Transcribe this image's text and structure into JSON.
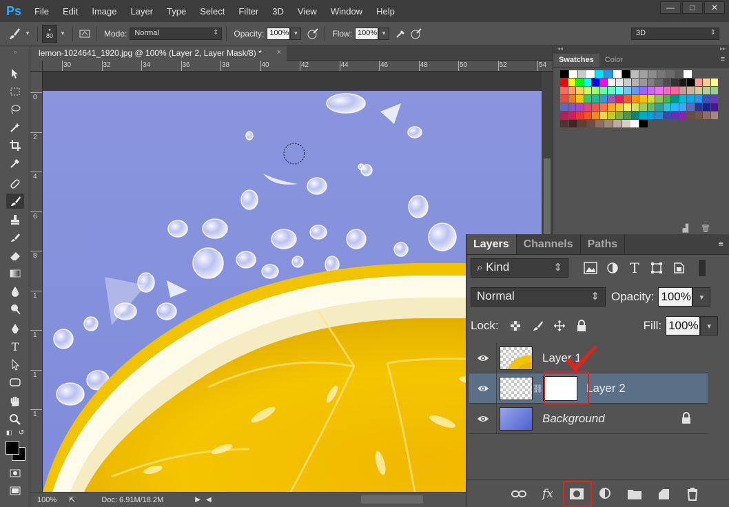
{
  "app": {
    "logo": "Ps",
    "menu": [
      "File",
      "Edit",
      "Image",
      "Layer",
      "Type",
      "Select",
      "Filter",
      "3D",
      "View",
      "Window",
      "Help"
    ],
    "window_controls": {
      "minimize": "—",
      "maximize": "□",
      "close": "✕"
    }
  },
  "options_bar": {
    "brush_size": "80",
    "mode_label": "Mode:",
    "mode_value": "Normal",
    "opacity_label": "Opacity:",
    "opacity_value": "100%",
    "flow_label": "Flow:",
    "flow_value": "100%",
    "workspace_value": "3D"
  },
  "document": {
    "tab_title": "lemon-1024641_1920.jpg @ 100% (Layer 2, Layer Mask/8) *",
    "close_glyph": "×",
    "ruler_h_labels": [
      "30",
      "32",
      "34",
      "36",
      "38",
      "40",
      "42",
      "44",
      "46",
      "48",
      "50",
      "52",
      "54"
    ],
    "ruler_v_labels": [
      "0",
      "2",
      "4",
      "6",
      "8",
      "1",
      "1",
      "1",
      "1"
    ],
    "status_zoom": "100%",
    "status_doc": "Doc: 6.91M/18.2M"
  },
  "swatches": {
    "tabs": [
      "Swatches",
      "Color"
    ],
    "menu_glyph": "≡",
    "colors": [
      [
        "#000000",
        "#ffffff",
        "#c8c8c8",
        "#ffffff",
        "#00e4ff",
        "#2196f3",
        "#ffffff",
        "#000000",
        "#bdbdbd",
        "#a0a0a0",
        "#8c8c8c",
        "#787878",
        "#6a6a6a",
        "#5a5a5a",
        "#ffffff"
      ],
      [
        "#ff0000",
        "#ffff00",
        "#00ff00",
        "#00ffff",
        "#0000ff",
        "#ff00ff",
        "#ffffff",
        "#e6e6e6",
        "#cccccc",
        "#b3b3b3",
        "#999999",
        "#808080",
        "#666666",
        "#4d4d4d",
        "#333333",
        "#1a1a1a",
        "#000000",
        "#ff9999",
        "#ffcc99",
        "#ffff99"
      ],
      [
        "#ff6666",
        "#ff9966",
        "#ffcc66",
        "#ccff66",
        "#99ff66",
        "#66ff99",
        "#66ffcc",
        "#66ffff",
        "#66ccff",
        "#6699ff",
        "#9966ff",
        "#cc66ff",
        "#ff66ff",
        "#ff66cc",
        "#ff6699",
        "#cc9999",
        "#ccb399",
        "#cccc99",
        "#b3cc99",
        "#99cc99"
      ],
      [
        "#e74c3c",
        "#e67e22",
        "#f1c40f",
        "#2ecc71",
        "#1abc9c",
        "#3498db",
        "#9b59b6",
        "#e91e63",
        "#ff5722",
        "#ff9800",
        "#ffc107",
        "#cddc39",
        "#8bc34a",
        "#4caf50",
        "#009688",
        "#00bcd4",
        "#03a9f4",
        "#2196f3",
        "#3f51b5",
        "#673ab7"
      ],
      [
        "#5c6bc0",
        "#7e57c2",
        "#ab47bc",
        "#ec407a",
        "#ef5350",
        "#ff7043",
        "#ffa726",
        "#ffca28",
        "#ffee58",
        "#d4e157",
        "#9ccc65",
        "#66bb6a",
        "#26a69a",
        "#26c6da",
        "#29b6f6",
        "#42a5f5",
        "#5c6bc0",
        "#283593",
        "#1a237e",
        "#4a148c"
      ],
      [
        "#c2185b",
        "#d81b60",
        "#e53935",
        "#f4511e",
        "#fb8c00",
        "#fdd835",
        "#c0ca33",
        "#7cb342",
        "#43a047",
        "#00897b",
        "#00acc1",
        "#039be5",
        "#1e88e5",
        "#3949ab",
        "#5e35b1",
        "#8e24aa",
        "#6d4c41",
        "#795548",
        "#8d6e63",
        "#a1887f"
      ],
      [
        "#4e342e",
        "#3e2723",
        "#5d4037",
        "#6d4c41",
        "#8d6e63",
        "#a1887f",
        "#bcaaa4",
        "#d7ccc8",
        "#ffffff",
        "#000000"
      ]
    ]
  },
  "layers_panel": {
    "tabs": [
      "Layers",
      "Channels",
      "Paths"
    ],
    "menu_glyph": "≡",
    "filter_kind": "Kind",
    "blend_mode": "Normal",
    "opacity_label": "Opacity:",
    "opacity_value": "100%",
    "lock_label": "Lock:",
    "fill_label": "Fill:",
    "fill_value": "100%",
    "layers": [
      {
        "name": "Layer 1",
        "selected": false,
        "visible": true
      },
      {
        "name": "Layer 2",
        "selected": true,
        "visible": true,
        "has_mask": true
      },
      {
        "name": "Background",
        "selected": false,
        "visible": true,
        "locked": true
      }
    ],
    "footer_fx": "fx"
  },
  "colors": {
    "sky_blue": "#8a95dd",
    "lemon_yellow": "#f2c500",
    "selection_blue": "#5b6f87",
    "highlight_red": "#e2231a"
  }
}
